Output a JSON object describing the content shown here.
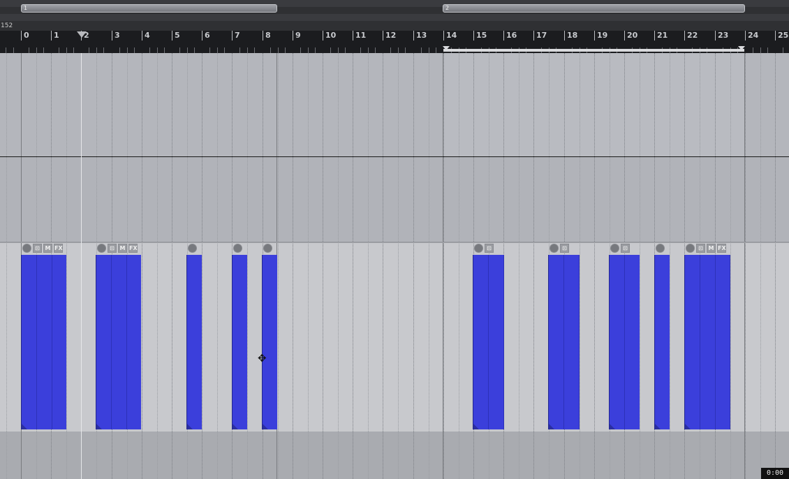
{
  "top_bar": {
    "tempo": "152",
    "loop_markers": [
      "1",
      "2"
    ]
  },
  "ruler": {
    "bar_numbers": [
      "0",
      "1",
      "2",
      "3",
      "4",
      "5",
      "6",
      "7",
      "8",
      "9",
      "10",
      "11",
      "12",
      "13",
      "14",
      "15",
      "16",
      "17",
      "18",
      "19",
      "20",
      "21",
      "22",
      "23",
      "24",
      "25"
    ]
  },
  "clip_headers": [
    [
      "clock-icon",
      "lock-icon",
      "M",
      "FX"
    ],
    [
      "clock-icon",
      "lock-icon",
      "M",
      "FX"
    ],
    [
      "clock-icon"
    ],
    [
      "clock-icon"
    ],
    [
      "clock-icon"
    ],
    [
      "clock-icon",
      "lock-icon"
    ],
    [
      "clock-icon",
      "lock-icon"
    ],
    [
      "clock-icon",
      "lock-icon"
    ],
    [
      "clock-icon"
    ],
    [
      "clock-icon",
      "lock-icon",
      "M",
      "FX"
    ]
  ],
  "colors": {
    "clip": "#3b3fdb",
    "background": "#b4b6bc",
    "ruler": "#1b1c1f"
  },
  "status": {
    "timecode": "0:00"
  }
}
